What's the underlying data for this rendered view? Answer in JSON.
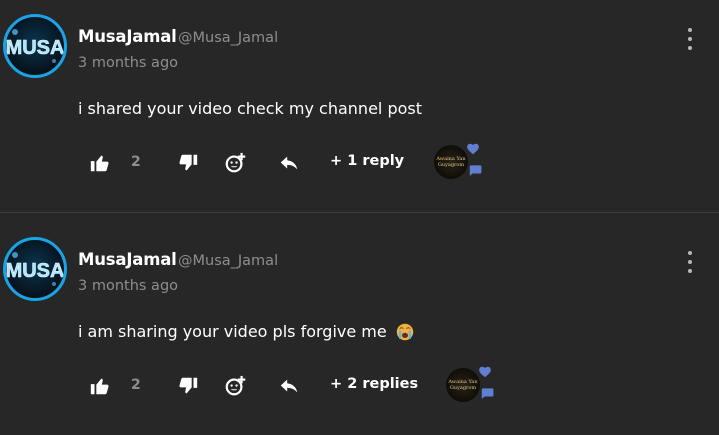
{
  "comments": [
    {
      "avatar_text": "MUSA",
      "author": "MusaJamal",
      "handle": "@Musa_Jamal",
      "time": "3 months ago",
      "text": "i shared your video check my channel post",
      "has_emoji": false,
      "like_count": "2",
      "replies_label": "+ 1 reply",
      "creator_badge_text": "Awaina Yan Guyagrom"
    },
    {
      "avatar_text": "MUSA",
      "author": "MusaJamal",
      "handle": "@Musa_Jamal",
      "time": "3 months ago",
      "text": "i am sharing your video pls forgive me",
      "has_emoji": true,
      "emoji_name": "crying-face",
      "like_count": "2",
      "replies_label": "+ 2 replies",
      "creator_badge_text": "Awaina Yan Guyagrom"
    }
  ],
  "colors": {
    "background": "#272727",
    "secondary_text": "#8e8e8e",
    "avatar_ring": "#1aa3e6",
    "badge_blue": "#5f7fd0"
  },
  "icons": [
    "more-vert-icon",
    "thumbs-up-icon",
    "thumbs-down-icon",
    "add-emoji-icon",
    "reply-arrow-icon",
    "heart-icon",
    "chat-bubble-icon"
  ]
}
